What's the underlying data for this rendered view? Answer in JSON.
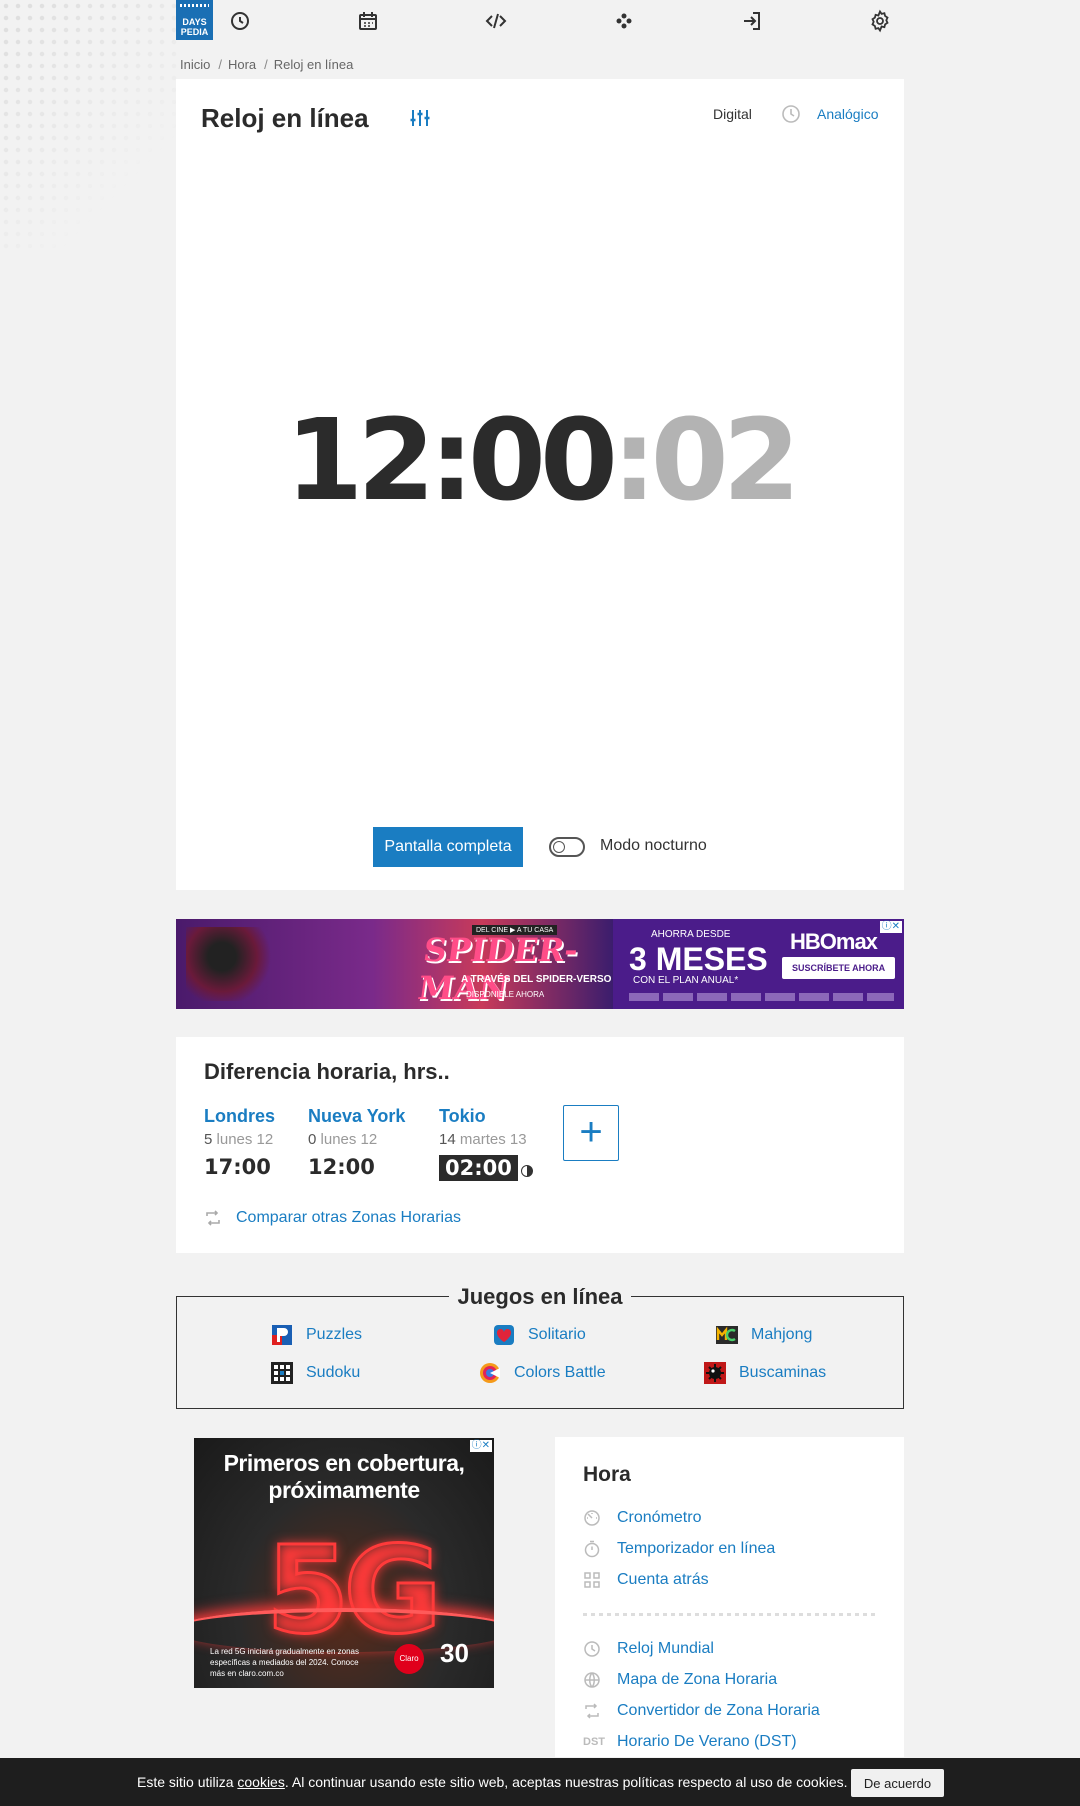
{
  "nav": {
    "logo_line1": "DAYS",
    "logo_line2": "PEDIA",
    "icons": [
      "clock-icon",
      "calendar-icon",
      "code-icon",
      "gamepad-icon",
      "login-icon",
      "gear-icon"
    ]
  },
  "breadcrumb": [
    "Inicio",
    "Hora",
    "Reloj en línea"
  ],
  "clock": {
    "title": "Reloj en línea",
    "mode_digital": "Digital",
    "mode_analog": "Analógico",
    "time_main": "12:00",
    "time_seconds": ":02",
    "fullscreen_label": "Pantalla completa",
    "night_mode_label": "Modo nocturno",
    "night_mode_on": false
  },
  "ad_banner": {
    "tag": "DEL CINE ▶ A TU CASA",
    "title": "SPIDER-MAN",
    "subtitle": "A TRAVÉS DEL SPIDER-VERSO",
    "available": "DISPONIBLE AHORA",
    "from": "AHORRA DESDE",
    "months": "3 MESES",
    "plan": "CON EL PLAN ANUAL*",
    "brand": "HBOmax",
    "cta": "SUSCRÍBETE AHORA"
  },
  "time_difference": {
    "title": "Diferencia horaria, hrs..",
    "cities": [
      {
        "name": "Londres",
        "offset": "5",
        "date": "lunes 12",
        "time": "17:00",
        "night": false
      },
      {
        "name": "Nueva York",
        "offset": "0",
        "date": "lunes 12",
        "time": "12:00",
        "night": false
      },
      {
        "name": "Tokio",
        "offset": "14",
        "date": "martes 13",
        "time": "02:00",
        "night": true
      }
    ],
    "add_label": "+",
    "compare_label": "Comparar otras Zonas Horarias"
  },
  "games": {
    "title": "Juegos en línea",
    "items": [
      "Puzzles",
      "Solitario",
      "Mahjong",
      "Sudoku",
      "Colors Battle",
      "Buscaminas"
    ]
  },
  "ad_side": {
    "headline": "Primeros en cobertura, próximamente",
    "big": "5G",
    "legal": "La red 5G iniciará gradualmente en zonas específicas a mediados del 2024. Conoce más en claro.com.co",
    "brand": "Claro",
    "anniv": "30"
  },
  "hora": {
    "title": "Hora",
    "links": [
      "Cronómetro",
      "Temporizador en línea",
      "Cuenta atrás",
      "Reloj Mundial",
      "Mapa de Zona Horaria",
      "Convertidor de Zona Horaria",
      "Horario De Verano (DST)"
    ]
  },
  "cookie": {
    "text_before": "Este sitio utiliza ",
    "link": "cookies",
    "text_after": ". Al continuar usando este sitio web, aceptas nuestras políticas respecto al uso de cookies.",
    "button": "De acuerdo"
  },
  "colors": {
    "accent": "#1a7dc2",
    "logo": "#1a6fb4",
    "text": "#2b2b2b",
    "seconds": "#b3b3b3"
  }
}
